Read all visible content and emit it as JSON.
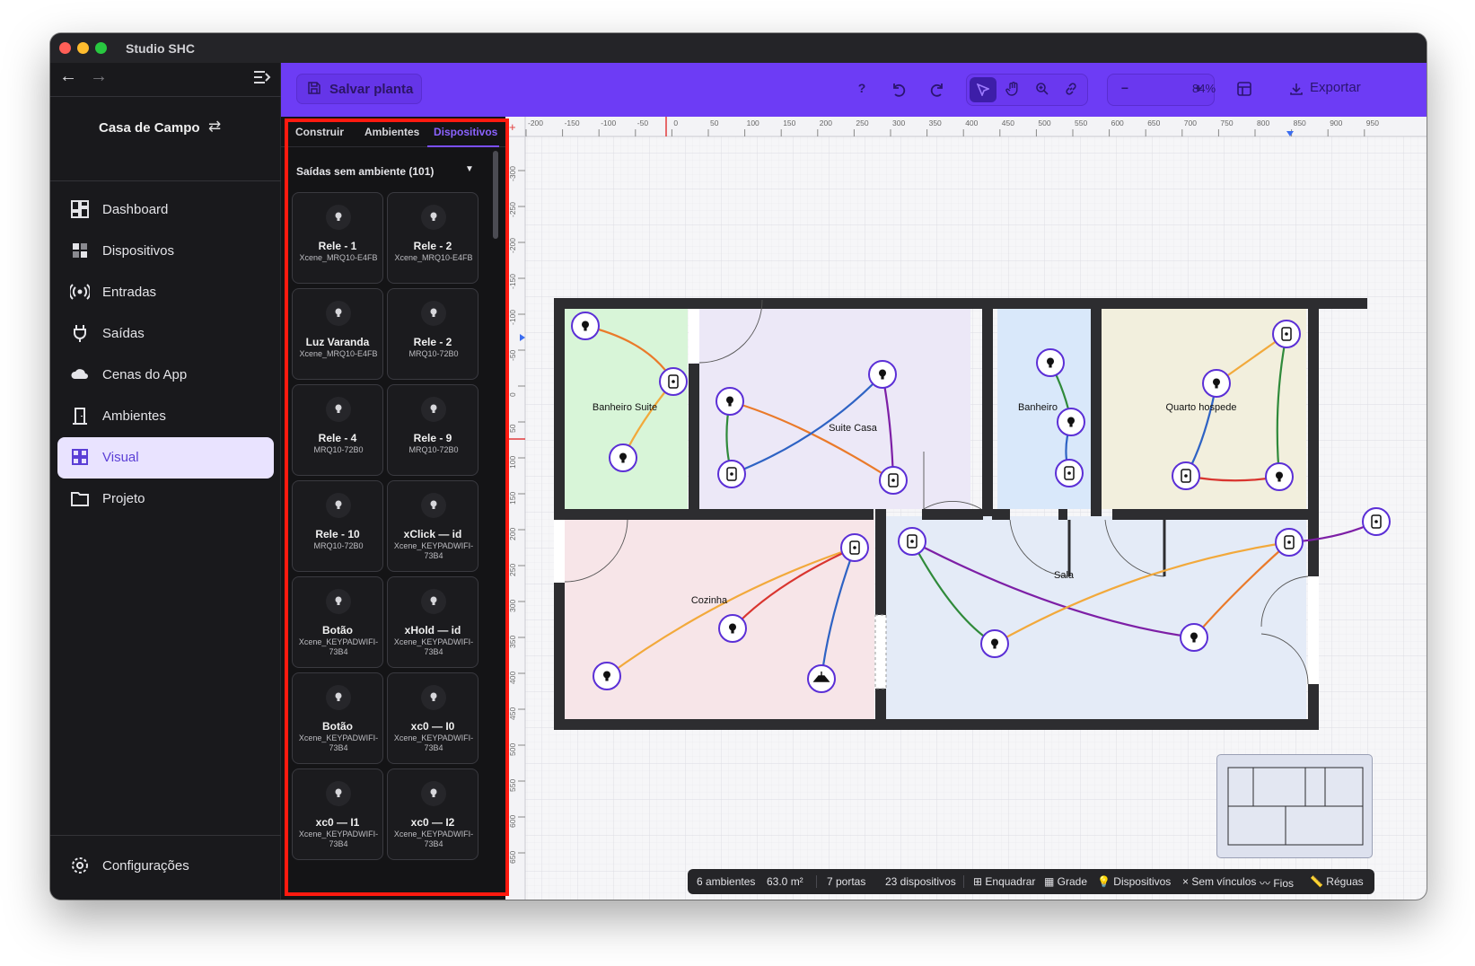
{
  "window": {
    "title": "Studio SHC"
  },
  "sidebar": {
    "project_name": "Casa de Campo",
    "items": [
      {
        "label": "Dashboard",
        "icon": "dashboard-icon"
      },
      {
        "label": "Dispositivos",
        "icon": "devices-icon"
      },
      {
        "label": "Entradas",
        "icon": "signal-icon"
      },
      {
        "label": "Saídas",
        "icon": "plug-icon"
      },
      {
        "label": "Cenas do App",
        "icon": "cloud-icon"
      },
      {
        "label": "Ambientes",
        "icon": "door-icon"
      },
      {
        "label": "Visual",
        "icon": "grid-icon"
      },
      {
        "label": "Projeto",
        "icon": "folder-icon"
      }
    ],
    "active": "Visual",
    "settings_label": "Configurações"
  },
  "panel": {
    "save_label": "Salvar planta",
    "tabs": [
      "Construir",
      "Ambientes",
      "Dispositivos"
    ],
    "active_tab": "Dispositivos",
    "group_title": "Saídas sem ambiente (101)",
    "cards": [
      {
        "title": "Rele - 1",
        "subtitle": "Xcene_MRQ10-E4FB"
      },
      {
        "title": "Rele - 2",
        "subtitle": "Xcene_MRQ10-E4FB"
      },
      {
        "title": "Luz Varanda",
        "subtitle": "Xcene_MRQ10-E4FB"
      },
      {
        "title": "Rele - 2",
        "subtitle": "MRQ10-72B0"
      },
      {
        "title": "Rele - 4",
        "subtitle": "MRQ10-72B0"
      },
      {
        "title": "Rele - 9",
        "subtitle": "MRQ10-72B0"
      },
      {
        "title": "Rele - 10",
        "subtitle": "MRQ10-72B0"
      },
      {
        "title": "xClick — id",
        "subtitle": "Xcene_KEYPADWIFI-73B4"
      },
      {
        "title": "Botão",
        "subtitle": "Xcene_KEYPADWIFI-73B4"
      },
      {
        "title": "xHold — id",
        "subtitle": "Xcene_KEYPADWIFI-73B4"
      },
      {
        "title": "Botão",
        "subtitle": "Xcene_KEYPADWIFI-73B4"
      },
      {
        "title": "xc0 — I0",
        "subtitle": "Xcene_KEYPADWIFI-73B4"
      },
      {
        "title": "xc0 — I1",
        "subtitle": "Xcene_KEYPADWIFI-73B4"
      },
      {
        "title": "xc0 — I2",
        "subtitle": "Xcene_KEYPADWIFI-73B4"
      }
    ]
  },
  "toolbar": {
    "help_label": "?",
    "zoom_label": "84%",
    "zoom_out": "−",
    "zoom_in": "+",
    "export_label": "Exportar"
  },
  "rulers": {
    "x_ticks": [
      "-200",
      "-150",
      "-100",
      "-50",
      "0",
      "50",
      "100",
      "150",
      "200",
      "250",
      "300",
      "350",
      "400",
      "450",
      "500",
      "550",
      "600",
      "650",
      "700",
      "750",
      "800",
      "850",
      "900",
      "950"
    ],
    "y_ticks": [
      "-300",
      "-250",
      "-200",
      "-150",
      "-100",
      "-50",
      "0",
      "50",
      "100",
      "150",
      "200",
      "250",
      "300",
      "350",
      "400",
      "450",
      "500",
      "550",
      "600",
      "650"
    ]
  },
  "rooms": [
    {
      "name": "Banheiro Suite",
      "color": "#d8f5d8"
    },
    {
      "name": "Suite Casa",
      "color": "#ece8f7"
    },
    {
      "name": "Banheiro",
      "color": "#d9e8fa"
    },
    {
      "name": "Quarto hospede",
      "color": "#f2efdd"
    },
    {
      "name": "Cozinha",
      "color": "#f7e5e8"
    },
    {
      "name": "Sala",
      "color": "#e4ebf7"
    }
  ],
  "status": {
    "rooms": "6 ambientes",
    "area": "63.0 m²",
    "doors": "7 portas",
    "devices": "23 dispositivos",
    "fit": "⊞ Enquadrar",
    "grid": "▦ Grade",
    "devices_toggle": "💡 Dispositivos",
    "unlinked": "× Sem vínculos",
    "wires": "〰 Fios",
    "rulers": "📏 Réguas"
  },
  "colors": {
    "accent": "#6d3cf5",
    "highlight": "#ff1a0f",
    "wire_orange": "#ea7a2a",
    "wire_yellow": "#f2a93b",
    "wire_blue": "#2e63c4",
    "wire_purple": "#7d1fa6",
    "wire_green": "#2f8a3a",
    "wire_red": "#d9352f"
  }
}
